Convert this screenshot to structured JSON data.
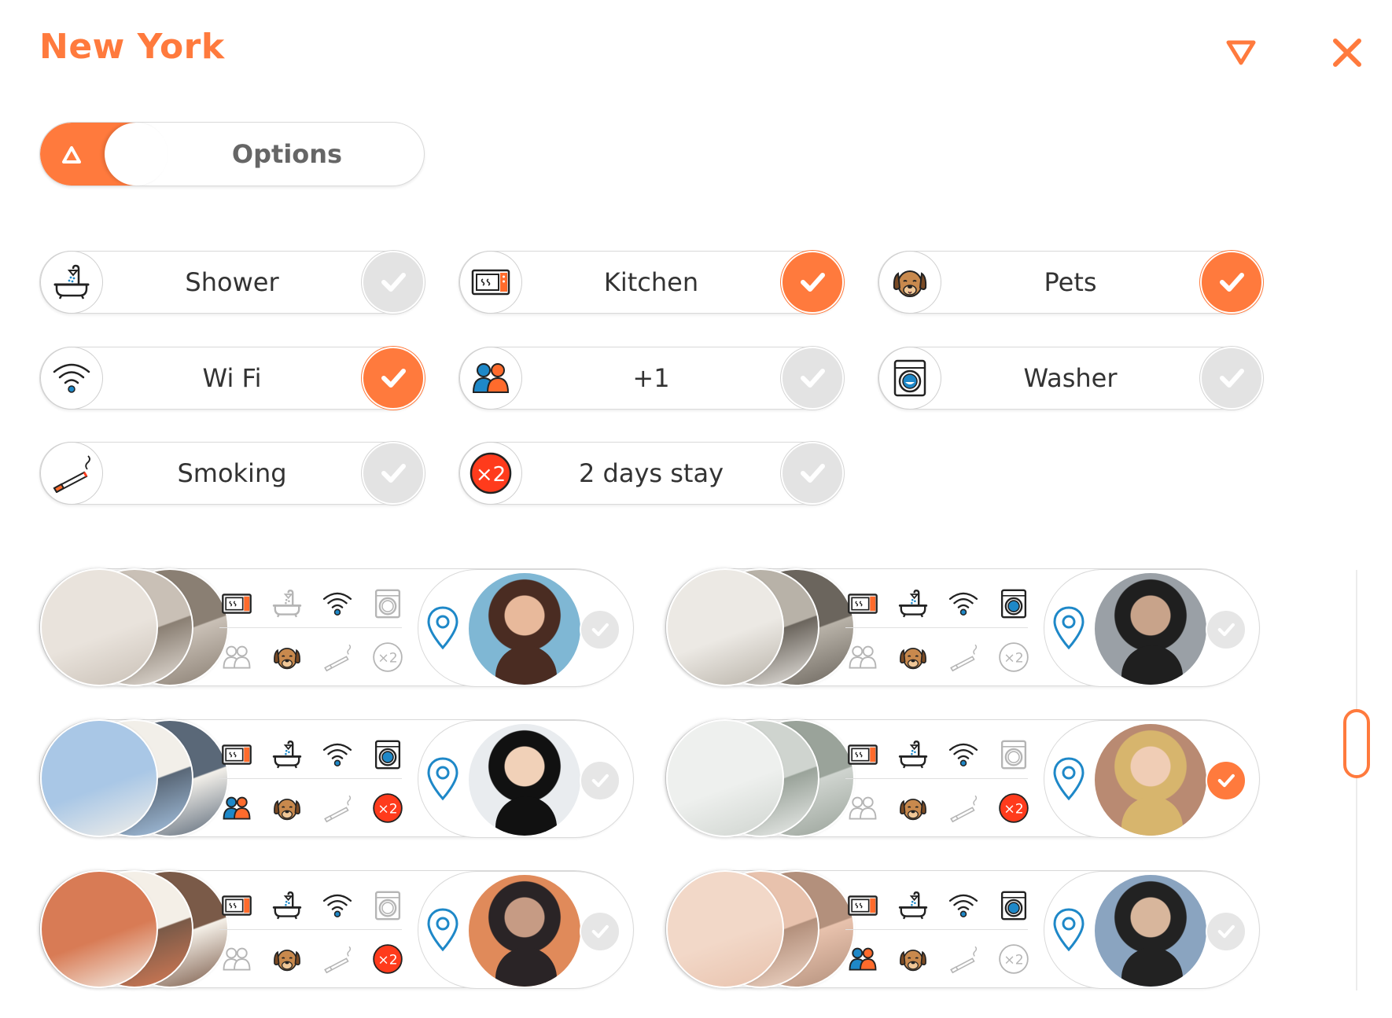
{
  "header": {
    "title": "New York",
    "accent_color": "#ff7a3d",
    "filter_icon": "triangle-down-icon",
    "close_icon": "close-icon"
  },
  "options_toggle": {
    "label": "Options",
    "icon": "triangle-up-icon"
  },
  "options": [
    {
      "label": "Shower",
      "icon": "bathtub-icon",
      "checked": false
    },
    {
      "label": "Kitchen",
      "icon": "microwave-icon",
      "checked": true
    },
    {
      "label": "Pets",
      "icon": "dog-icon",
      "checked": true
    },
    {
      "label": "Wi Fi",
      "icon": "wifi-icon",
      "checked": true
    },
    {
      "label": "+1",
      "icon": "people-icon",
      "checked": false
    },
    {
      "label": "Washer",
      "icon": "washer-icon",
      "checked": false
    },
    {
      "label": "Smoking",
      "icon": "cigarette-icon",
      "checked": false
    },
    {
      "label": "2 days stay",
      "icon": "x2-icon",
      "checked": false
    }
  ],
  "listings": [
    {
      "amenities": {
        "kitchen": true,
        "shower": false,
        "wifi": true,
        "washer": false,
        "plus_one": false,
        "pets": true,
        "smoking": false,
        "two_days": false
      },
      "selected": false,
      "x2_label": "×2"
    },
    {
      "amenities": {
        "kitchen": true,
        "shower": true,
        "wifi": true,
        "washer": true,
        "plus_one": false,
        "pets": true,
        "smoking": false,
        "two_days": false
      },
      "selected": false,
      "x2_label": "×2"
    },
    {
      "amenities": {
        "kitchen": true,
        "shower": true,
        "wifi": true,
        "washer": true,
        "plus_one": true,
        "pets": true,
        "smoking": false,
        "two_days": true
      },
      "selected": false,
      "x2_label": "×2"
    },
    {
      "amenities": {
        "kitchen": true,
        "shower": true,
        "wifi": true,
        "washer": false,
        "plus_one": false,
        "pets": true,
        "smoking": false,
        "two_days": true
      },
      "selected": true,
      "x2_label": "×2"
    },
    {
      "amenities": {
        "kitchen": true,
        "shower": true,
        "wifi": true,
        "washer": false,
        "plus_one": false,
        "pets": true,
        "smoking": false,
        "two_days": true
      },
      "selected": false,
      "x2_label": "×2"
    },
    {
      "amenities": {
        "kitchen": true,
        "shower": true,
        "wifi": true,
        "washer": true,
        "plus_one": true,
        "pets": true,
        "smoking": false,
        "two_days": false
      },
      "selected": false,
      "x2_label": "×2"
    }
  ],
  "x2_text": "×2"
}
